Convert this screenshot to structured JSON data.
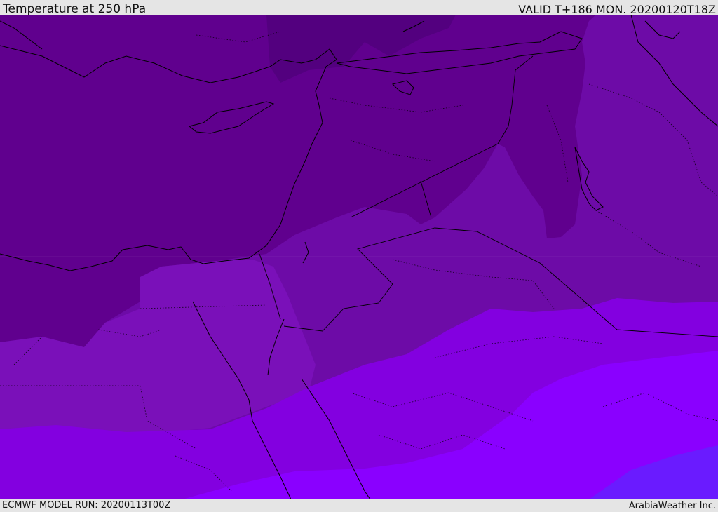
{
  "header": {
    "title": "Temperature at 250 hPa",
    "valid": "VALID T+186 MON. 20200120T18Z"
  },
  "footer": {
    "model_run": "ECMWF MODEL RUN: 20200113T00Z",
    "credit": "ArabiaWeather Inc."
  },
  "colors": {
    "background": "#e5e5e5",
    "band_darkest": "#53007f",
    "band_dark": "#60008e",
    "band_mid": "#6d0ba7",
    "band_purple": "#7a10b9",
    "band_violet": "#8300e0",
    "band_bright": "#8a00ff",
    "band_blue": "#6a1bff",
    "coastline": "#000000"
  }
}
